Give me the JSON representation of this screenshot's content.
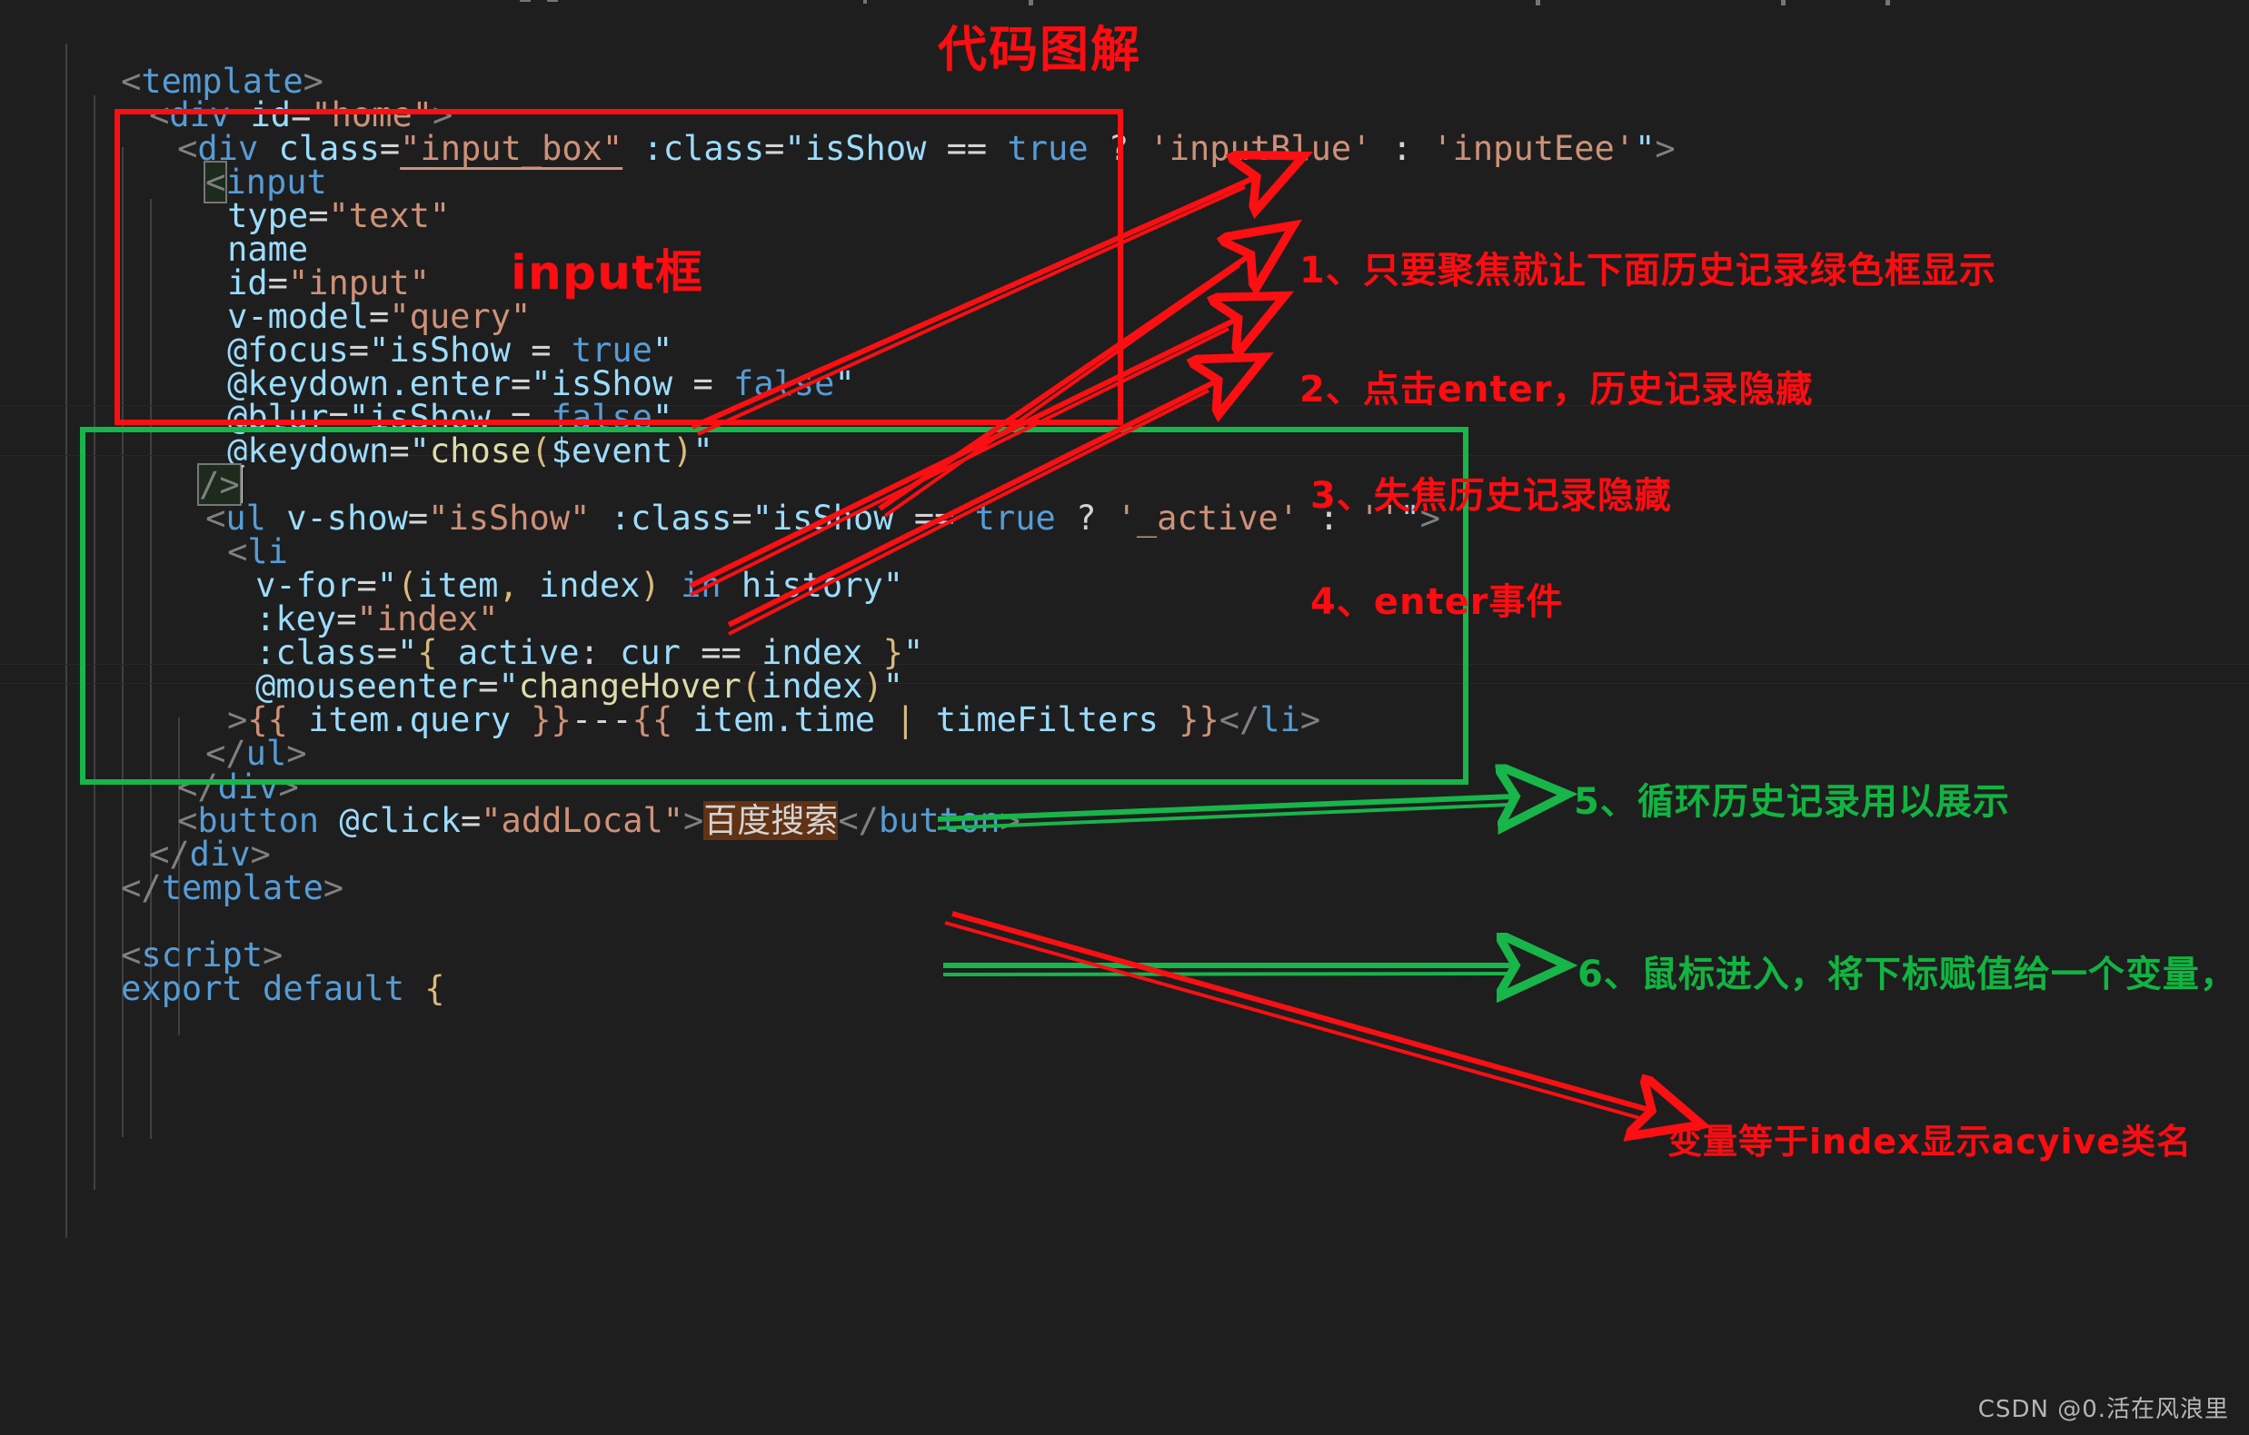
{
  "editor": {
    "theme": "dark",
    "background_color": "#1e1e1e",
    "caret_visible": true,
    "lines": [
      {
        "indent": 0,
        "text": "<template>"
      },
      {
        "indent": 1,
        "text": "<div id=\"home\">"
      },
      {
        "indent": 2,
        "text": "<div class=\"input_box\" :class=\"isShow == true ? 'inputBlue' : 'inputEee'\">"
      },
      {
        "indent": 3,
        "text": "<input"
      },
      {
        "indent": 4,
        "text": "type=\"text\""
      },
      {
        "indent": 4,
        "text": "name"
      },
      {
        "indent": 4,
        "text": "id=\"input\""
      },
      {
        "indent": 4,
        "text": "v-model=\"query\""
      },
      {
        "indent": 4,
        "text": "@focus=\"isShow = true\""
      },
      {
        "indent": 4,
        "text": "@keydown.enter=\"isShow = false\""
      },
      {
        "indent": 4,
        "text": "@blur=\"isShow = false\""
      },
      {
        "indent": 4,
        "text": "@keydown=\"chose($event)\""
      },
      {
        "indent": 3,
        "text": "/>"
      },
      {
        "indent": 3,
        "text": "<ul v-show=\"isShow\" :class=\"isShow == true ? '_active' : ''\">"
      },
      {
        "indent": 4,
        "text": "<li"
      },
      {
        "indent": 5,
        "text": "v-for=\"(item, index) in history\""
      },
      {
        "indent": 5,
        "text": ":key=\"index\""
      },
      {
        "indent": 5,
        "text": ":class=\"{ active: cur == index }\""
      },
      {
        "indent": 5,
        "text": "@mouseenter=\"changeHover(index)\""
      },
      {
        "indent": 4,
        "text": ">{{ item.query }}---{{ item.time | timeFilters }}</li>"
      },
      {
        "indent": 3,
        "text": "</ul>"
      },
      {
        "indent": 2,
        "text": "</div>"
      },
      {
        "indent": 2,
        "text": "<button @click=\"addLocal\">百度搜索</button>"
      },
      {
        "indent": 1,
        "text": "</div>"
      },
      {
        "indent": 0,
        "text": "</template>"
      },
      {
        "indent": 0,
        "text": ""
      },
      {
        "indent": 0,
        "text": "<script>"
      },
      {
        "indent": 0,
        "text": "export default {"
      }
    ],
    "selected_text": "百度搜索"
  },
  "annotations": {
    "title": "代码图解",
    "input_box_label": "input框",
    "red_box_color": "#fa0f12",
    "green_box_color": "#18b54a",
    "red_text_color": "#fb0d11",
    "green_text_color": "#11b441",
    "notes": [
      {
        "id": "note-1",
        "number": "1、",
        "text": "只要聚焦就让下面历史记录绿色框显示",
        "color": "red"
      },
      {
        "id": "note-2",
        "number": "2、",
        "text": "点击enter，历史记录隐藏",
        "color": "red"
      },
      {
        "id": "note-3",
        "number": "3、",
        "text": "失焦历史记录隐藏",
        "color": "red"
      },
      {
        "id": "note-4",
        "number": "4、",
        "text": "enter事件",
        "color": "red"
      },
      {
        "id": "note-5",
        "number": "5、",
        "text": "循环历史记录用以展示",
        "color": "green"
      },
      {
        "id": "note-6",
        "number": "6、",
        "text": "鼠标进入，将下标赋值给一个变量，",
        "color": "green"
      }
    ],
    "bottom_note": "变量等于index显示acyive类名"
  },
  "watermark": "CSDN @0.活在风浪里"
}
